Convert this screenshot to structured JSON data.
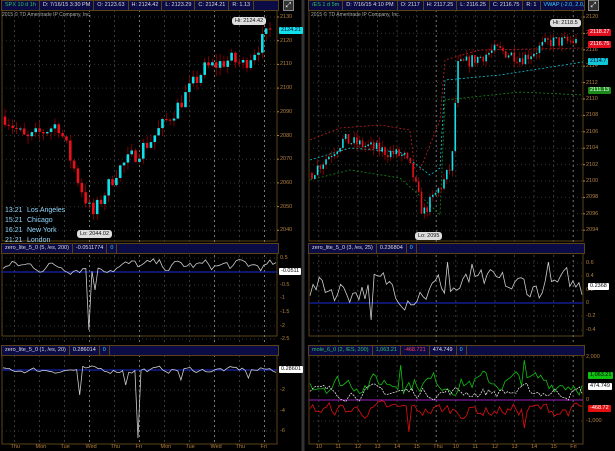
{
  "left": {
    "header": {
      "symbol": "SPX 10 d 1h",
      "date": "D: 7/16/15 3:30 PM",
      "open": "O: 2123.63",
      "high": "H: 2124.42",
      "low": "L: 2123.29",
      "close": "C: 2124.21",
      "range": "R: 1.13"
    },
    "copyright": "2015 © TD Ameritrade IP Company, Inc.",
    "price_axis": [
      "2130",
      "2120",
      "2110",
      "2100",
      "2090",
      "2080",
      "2070",
      "2060",
      "2050",
      "2040"
    ],
    "last_price": "2124.21",
    "high_bubble": "Hi: 2124.42",
    "low_bubble": "Lo: 2044.02",
    "timezones": [
      {
        "time": "13:21",
        "city": "Los Angeles"
      },
      {
        "time": "15:21",
        "city": "Chicago"
      },
      {
        "time": "16:21",
        "city": "New York"
      },
      {
        "time": "21:21",
        "city": "London"
      }
    ],
    "study1": {
      "name": "zero_lite_5_0 (5, /es, 200)",
      "value": "-0.0511774",
      "extra": "0",
      "axis": [
        "0.5",
        "-0.5",
        "-1",
        "-1.5",
        "-2",
        "-2.5"
      ],
      "tag": "-0.0511"
    },
    "study2": {
      "name": "zero_lite_5_0 (1, /es, 20)",
      "value": "0.286014",
      "extra": "0",
      "axis": [
        "-2",
        "-4",
        "-6"
      ],
      "tag": "0.28601"
    },
    "x_axis": [
      "Thu",
      "Mon",
      "Tue",
      "Wed",
      "Thu",
      "Fri",
      "Mon",
      "Tue",
      "Wed",
      "Thu",
      "Fri"
    ]
  },
  "right": {
    "header": {
      "symbol": "/ES 1 d 5m",
      "date": "D: 7/16/15 4:10 PM",
      "open": "O: 2117",
      "high": "H: 2117.25",
      "low": "L: 2116.25",
      "close": "C: 2116.75",
      "range": "R: 1",
      "study": "VWAP (-2.0, 2.0, DAY)",
      "more": "..."
    },
    "copyright": "2015 © TD Ameritrade IP Company, Inc.",
    "price_axis": [
      "2120",
      "2118",
      "2116",
      "2114",
      "2112",
      "2110",
      "2108",
      "2106",
      "2104",
      "2102",
      "2100",
      "2098",
      "2096",
      "2094"
    ],
    "tags": [
      {
        "label": "2118.27",
        "color": "#e01020"
      },
      {
        "label": "2116.75",
        "color": "#e01020"
      },
      {
        "label": "2114.7",
        "color": "#10c8d8"
      },
      {
        "label": "2111.13",
        "color": "#1a8a1a"
      }
    ],
    "high_bubble": "Hi: 2118.5",
    "low_bubble": "Lo: 2095",
    "study1": {
      "name": "zero_lite_5_0 (3, /es, 25)",
      "value": "0.236804",
      "extra": "0",
      "axis": [
        "0.6",
        "0.4",
        "0.2",
        "0",
        "-0.2",
        "-0.4"
      ],
      "tag": "0.2368"
    },
    "study2": {
      "name": "mole_6_0 (2, /ES, 200)",
      "value_green": "1,063.21",
      "value_red": "-468.721",
      "value_white": "474.749",
      "extra": "0",
      "axis": [
        "2,000",
        "0",
        "-1,000"
      ],
      "tags": [
        "1,063.21",
        "474.749",
        "-468.72"
      ]
    },
    "x_axis": [
      "10",
      "11",
      "12",
      "13",
      "14",
      "15",
      "Thu",
      "10",
      "11",
      "12",
      "13",
      "14",
      "15",
      "Fri"
    ]
  },
  "colors": {
    "up": "#10e0e8",
    "down": "#e8101a",
    "axis": "#b08040",
    "zero": "#1a2ad8",
    "green": "#10c010",
    "red": "#e01010"
  },
  "price_path_left": [
    [
      0,
      2088
    ],
    [
      0.08,
      2078
    ],
    [
      0.2,
      2085
    ],
    [
      0.28,
      2060
    ],
    [
      0.33,
      2046
    ],
    [
      0.42,
      2065
    ],
    [
      0.55,
      2078
    ],
    [
      0.65,
      2092
    ],
    [
      0.75,
      2108
    ],
    [
      0.85,
      2112
    ],
    [
      0.9,
      2110
    ],
    [
      1,
      2124
    ]
  ],
  "price_path_right": [
    [
      0,
      2101
    ],
    [
      0.12,
      2105
    ],
    [
      0.35,
      2103
    ],
    [
      0.38,
      2101
    ],
    [
      0.42,
      2096
    ],
    [
      0.5,
      2100
    ],
    [
      0.53,
      2102
    ],
    [
      0.55,
      2114
    ],
    [
      0.7,
      2116
    ],
    [
      0.8,
      2115
    ],
    [
      0.9,
      2117
    ],
    [
      1,
      2117
    ]
  ]
}
